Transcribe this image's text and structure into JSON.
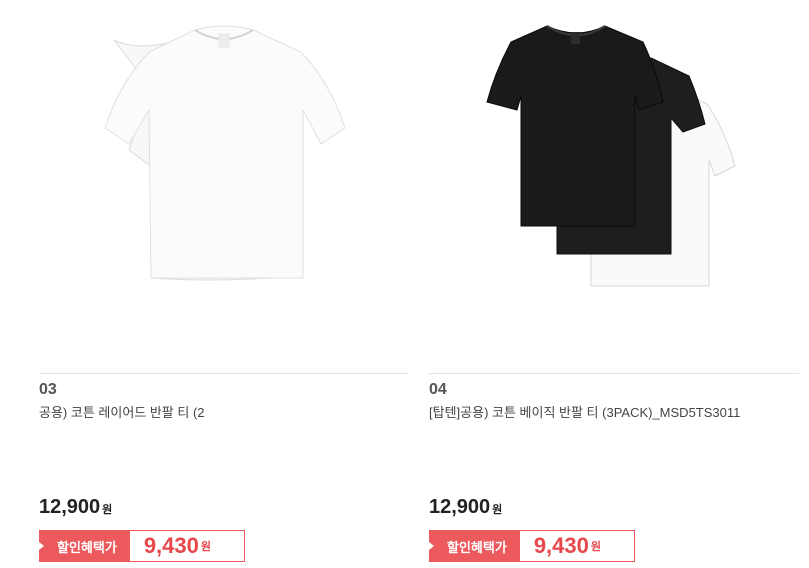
{
  "products": [
    {
      "rank": "03",
      "name": "공용) 코튼 레이어드 반팔 티 (2",
      "price": "12,900",
      "price_unit": "원",
      "sale_label": "할인혜택가",
      "sale_price": "9,430",
      "sale_unit": "원",
      "image_icon": "white-tshirt-image",
      "tshirt_color": "#ffffff"
    },
    {
      "rank": "04",
      "name": "[탑텐]공용) 코튼 베이직 반팔 티 (3PACK)_MSD5TS3011",
      "price": "12,900",
      "price_unit": "원",
      "sale_label": "할인혜택가",
      "sale_price": "9,430",
      "sale_unit": "원",
      "image_icon": "tshirt-3pack-image",
      "tshirt_colors": [
        "#1a1a1a",
        "#1a1a1a",
        "#ffffff"
      ]
    }
  ],
  "colors": {
    "accent": "#ec5a5e",
    "sale_text": "#e8474c"
  }
}
